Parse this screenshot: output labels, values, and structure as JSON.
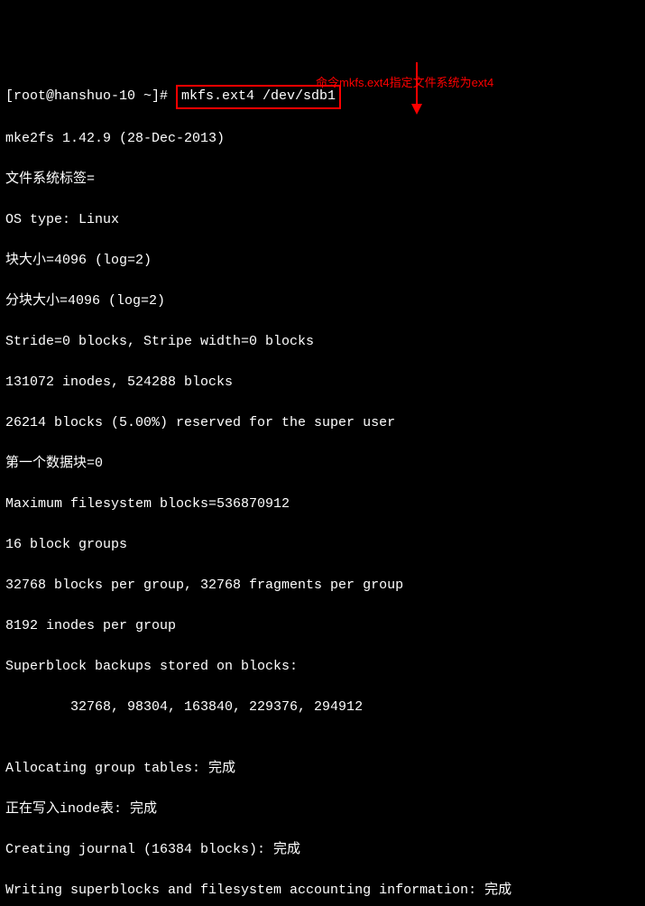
{
  "prompt": {
    "open": "[root@hanshuo-10 ~]# ",
    "command": "mkfs.ext4 /dev/sdb1"
  },
  "annotation": {
    "text": "命令mkfs.ext4指定文件系统为ext4"
  },
  "lines": [
    "mke2fs 1.42.9 (28-Dec-2013)",
    "文件系统标签=",
    "OS type: Linux",
    "块大小=4096 (log=2)",
    "分块大小=4096 (log=2)",
    "Stride=0 blocks, Stripe width=0 blocks",
    "131072 inodes, 524288 blocks",
    "26214 blocks (5.00%) reserved for the super user",
    "第一个数据块=0",
    "Maximum filesystem blocks=536870912",
    "16 block groups",
    "32768 blocks per group, 32768 fragments per group",
    "8192 inodes per group",
    "Superblock backups stored on blocks:",
    "        32768, 98304, 163840, 229376, 294912",
    "",
    "Allocating group tables: 完成",
    "正在写入inode表: 完成",
    "Creating journal (16384 blocks): 完成",
    "Writing superblocks and filesystem accounting information: 完成"
  ]
}
